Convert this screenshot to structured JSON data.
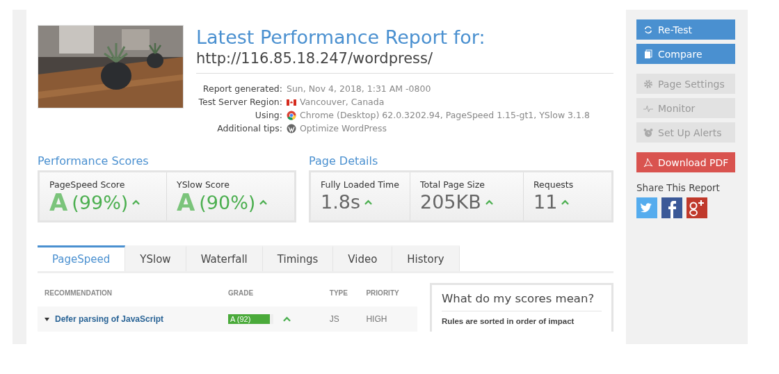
{
  "report": {
    "title": "Latest Performance Report for:",
    "url": "http://116.85.18.247/wordpress/",
    "details": [
      {
        "label": "Report generated:",
        "value": "Sun, Nov 4, 2018, 1:31 AM -0800"
      },
      {
        "label": "Test Server Region:",
        "value": "Vancouver, Canada"
      },
      {
        "label": "Using:",
        "value": "Chrome (Desktop) 62.0.3202.94, PageSpeed 1.15-gt1, YSlow 3.1.8"
      },
      {
        "label": "Additional tips:",
        "value": "Optimize WordPress"
      }
    ]
  },
  "performance_scores": {
    "title": "Performance Scores",
    "items": [
      {
        "label": "PageSpeed Score",
        "grade": "A",
        "value": "(99%)"
      },
      {
        "label": "YSlow Score",
        "grade": "A",
        "value": "(90%)"
      }
    ]
  },
  "page_details": {
    "title": "Page Details",
    "items": [
      {
        "label": "Fully Loaded Time",
        "value": "1.8s"
      },
      {
        "label": "Total Page Size",
        "value": "205KB"
      },
      {
        "label": "Requests",
        "value": "11"
      }
    ]
  },
  "tabs": [
    {
      "label": "PageSpeed",
      "selected": true
    },
    {
      "label": "YSlow",
      "selected": false
    },
    {
      "label": "Waterfall",
      "selected": false
    },
    {
      "label": "Timings",
      "selected": false
    },
    {
      "label": "Video",
      "selected": false
    },
    {
      "label": "History",
      "selected": false
    }
  ],
  "table": {
    "columns": [
      "RECOMMENDATION",
      "GRADE",
      "TYPE",
      "PRIORITY"
    ],
    "rows": [
      {
        "recommendation": "Defer parsing of JavaScript",
        "grade": "A (92)",
        "level": 0.92,
        "type": "JS",
        "priority": "HIGH",
        "expanded": false
      }
    ]
  },
  "info_box": {
    "title": "What do my scores mean?",
    "text": "Rules are sorted in order of impact"
  },
  "sidebar": {
    "actions": [
      {
        "label": "Re-Test",
        "kind": "primary"
      },
      {
        "label": "Compare",
        "kind": "primary"
      },
      {
        "label": "Page Settings",
        "kind": "muted"
      },
      {
        "label": "Monitor",
        "kind": "muted"
      },
      {
        "label": "Set Up Alerts",
        "kind": "muted"
      },
      {
        "label": "Download PDF",
        "kind": "danger"
      }
    ],
    "share_title": "Share This Report"
  }
}
